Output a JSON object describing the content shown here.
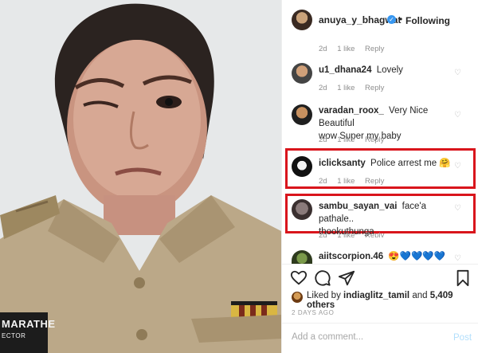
{
  "photo": {
    "nametag": "MARATHE",
    "nametag_sub": "ECTOR"
  },
  "header": {
    "username": "anuya_y_bhagwat",
    "following": "Following",
    "dot": "•"
  },
  "first_meta": {
    "time": "2d",
    "likes": "1 like",
    "reply": "Reply"
  },
  "comments": [
    {
      "user": "u1_dhana24",
      "text": "Lovely",
      "line2": "",
      "time": "2d",
      "likes": "1 like",
      "reply": "Reply"
    },
    {
      "user": "varadan_roox_",
      "text": "Very Nice Beautiful",
      "line2": "wow Super my baby",
      "time": "2d",
      "likes": "1 like",
      "reply": "Reply"
    },
    {
      "user": "iclicksanty",
      "text": "Police arrest me 🤗",
      "line2": "",
      "time": "2d",
      "likes": "1 like",
      "reply": "Reply"
    },
    {
      "user": "sambu_sayan_vai",
      "text": "face'a pathale..",
      "line2": "thookuthunga",
      "time": "2d",
      "likes": "1 like",
      "reply": "Reply"
    },
    {
      "user": "aiitscorpion.46",
      "text": "😍💙💙💙💙",
      "line2": "",
      "time": "",
      "likes": "",
      "reply": ""
    }
  ],
  "likes": {
    "prefix": "Liked by",
    "user": "indiaglitz_tamil",
    "and": "and",
    "others": "5,409 others"
  },
  "time_ago": "2 DAYS AGO",
  "add_comment": {
    "placeholder": "Add a comment...",
    "post_label": "Post"
  },
  "colors": {
    "highlight": "#d9151c",
    "verified": "#3897f0",
    "post_disabled": "#b2dffc"
  }
}
